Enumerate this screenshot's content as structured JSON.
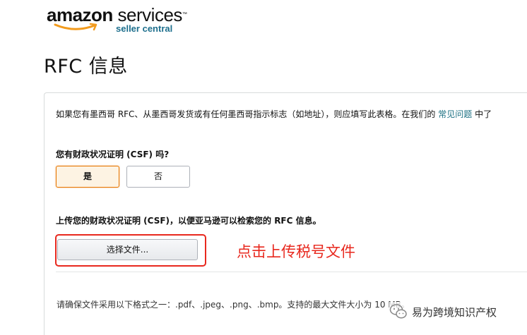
{
  "logo": {
    "brand": "amazon",
    "services": "services",
    "sub": "seller central"
  },
  "page": {
    "title": "RFC 信息"
  },
  "intro": {
    "text": "如果您有墨西哥 RFC、从墨西哥发货或有任何墨西哥指示标志（如地址），则应填写此表格。在我们的",
    "link": "常见问题",
    "tail": "中了"
  },
  "csf_question": {
    "label": "您有财政状况证明 (CSF) 吗?",
    "yes": "是",
    "no": "否",
    "selected": "是"
  },
  "upload": {
    "label": "上传您的财政状况证明 (CSF)，以便亚马逊可以检索您的 RFC 信息。",
    "button": "选择文件..."
  },
  "annotation": {
    "text": "点击上传税号文件"
  },
  "formats": {
    "text": "请确保文件采用以下格式之一：.pdf、.jpeg、.png、.bmp。支持的最大文件大小为 10 MB。"
  },
  "watermark": {
    "text": "易为跨境知识产权"
  },
  "colors": {
    "accent_orange": "#e77600",
    "link_teal": "#1b7082",
    "annotation_red": "#e8281e"
  }
}
